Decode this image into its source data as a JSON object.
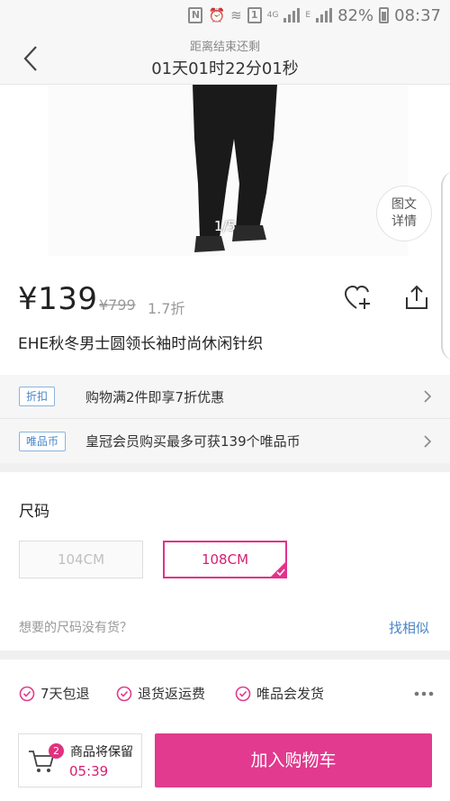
{
  "status_bar": {
    "battery": "82%",
    "time": "08:37",
    "network_4g": "4G",
    "network_e": "E"
  },
  "header": {
    "countdown_label": "距离结束还剩",
    "countdown_value": "01天01时22分01秒"
  },
  "gallery": {
    "page_indicator": "1/5",
    "detail_button_line1": "图文",
    "detail_button_line2": "详情"
  },
  "product": {
    "price": "¥139",
    "original_price": "¥799",
    "discount": "1.7折",
    "title": "EHE秋冬男士圆领长袖时尚休闲针织"
  },
  "promos": [
    {
      "tag": "折扣",
      "text": "购物满2件即享7折优惠"
    },
    {
      "tag": "唯品币",
      "text": "皇冠会员购买最多可获139个唯品币"
    }
  ],
  "size": {
    "label": "尺码",
    "options": [
      {
        "label": "104CM",
        "state": "disabled"
      },
      {
        "label": "108CM",
        "state": "selected"
      }
    ],
    "out_of_stock_text": "想要的尺码没有货？",
    "find_similar": "找相似"
  },
  "services": [
    {
      "label": "7天包退",
      "icon": "check-circle-icon"
    },
    {
      "label": "退货返运费",
      "icon": "check-circle-icon"
    },
    {
      "label": "唯品会发货",
      "icon": "check-circle-icon"
    }
  ],
  "bottom_bar": {
    "cart_count": "2",
    "cart_label": "商品将保留",
    "cart_timer": "05:39",
    "add_to_cart": "加入购物车"
  },
  "colors": {
    "accent": "#e13a8e",
    "link": "#4a86c6"
  }
}
